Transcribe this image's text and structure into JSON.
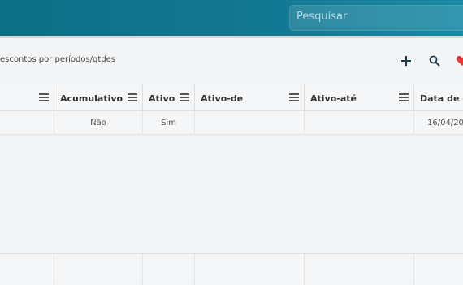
{
  "header": {
    "search_placeholder": "Pesquisar"
  },
  "toolbar": {
    "breadcrumb": "escontos por períodos/qtdes",
    "add_icon": "plus-icon",
    "search_icon": "search-icon",
    "favorite_icon": "heart-icon",
    "favorite_color": "#e53935",
    "accent": "#137893"
  },
  "table": {
    "columns": [
      "",
      "Acumulativo",
      "Ativo",
      "Ativo-de",
      "Ativo-até",
      "Data de c"
    ],
    "rows": [
      [
        "",
        "Não",
        "Sim",
        "",
        "",
        "16/04/20"
      ]
    ]
  }
}
